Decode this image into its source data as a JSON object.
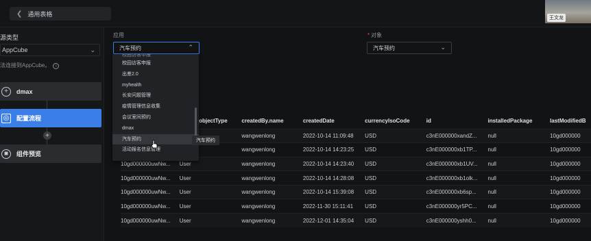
{
  "tab": {
    "title": "通用表格"
  },
  "user": {
    "name": "王文龙"
  },
  "sidebar": {
    "type_label": "源类型",
    "type_value": "AppCube",
    "hint": "法连接到AppCube。",
    "steps": [
      {
        "icon": "+",
        "label": "dmax"
      },
      {
        "icon": "◎",
        "label": "配置流程"
      },
      {
        "icon": "■",
        "label": "组件预览"
      }
    ]
  },
  "form": {
    "app_label": "应用",
    "app_value": "汽车预约",
    "object_label": "对象",
    "object_required": "*",
    "object_value": "汽车预约"
  },
  "dropdown": {
    "options": [
      "校园访客申报",
      "校园访客申报",
      "出差2.0",
      "myhealth",
      "长安问题管理",
      "疫情管理信息收集",
      "会议室间预约",
      "dmax",
      "汽车预约",
      "活动报名信息管理"
    ],
    "hovered_index": 8
  },
  "tooltip": {
    "text": "汽车预约"
  },
  "table": {
    "columns": [
      "",
      "tedBy._objectType",
      "createdBy.name",
      "createdDate",
      "currencyIsoCode",
      "id",
      "installedPackage",
      "lastModifiedB"
    ],
    "rows": [
      [
        "",
        "",
        "wangwenlong",
        "2022-10-14 11:09:48",
        "USD",
        "c3nE000000xandZ...",
        "null",
        "10gd000000"
      ],
      [
        "",
        "",
        "wangwenlong",
        "2022-10-14 14:23:25",
        "USD",
        "c3nE000000xb1TP...",
        "null",
        "10gd000000"
      ],
      [
        "10gd000000uwNw...",
        "User",
        "wangwenlong",
        "2022-10-14 14:23:40",
        "USD",
        "c3nE000000xb1UV...",
        "null",
        "10gd000000"
      ],
      [
        "10gd000000uwNw...",
        "User",
        "wangwenlong",
        "2022-10-14 14:28:08",
        "USD",
        "c3nE000000xb1olk...",
        "null",
        "10gd000000"
      ],
      [
        "10gd000000uwNw...",
        "User",
        "wangwenlong",
        "2022-10-14 15:39:08",
        "USD",
        "c3nE000000xb6sp...",
        "null",
        "10gd000000"
      ],
      [
        "10gd000000uwNw...",
        "User",
        "wangwenlong",
        "2022-11-30 15:11:41",
        "USD",
        "c3nE000000yr5PC...",
        "null",
        "10gd000000"
      ],
      [
        "10gd000000uwNw...",
        "User",
        "wangwenlong",
        "2022-12-01 14:35:04",
        "USD",
        "c3nE000000yshh0...",
        "null",
        "10gd000000"
      ]
    ]
  },
  "colors": {
    "accent": "#3b7ee8",
    "required": "#e05050"
  },
  "icons": {
    "back": "chevron-left-icon",
    "select_open": "chevron-up-icon",
    "select_closed": "chevron-down-icon",
    "info": "info-icon",
    "add": "plus-icon"
  }
}
